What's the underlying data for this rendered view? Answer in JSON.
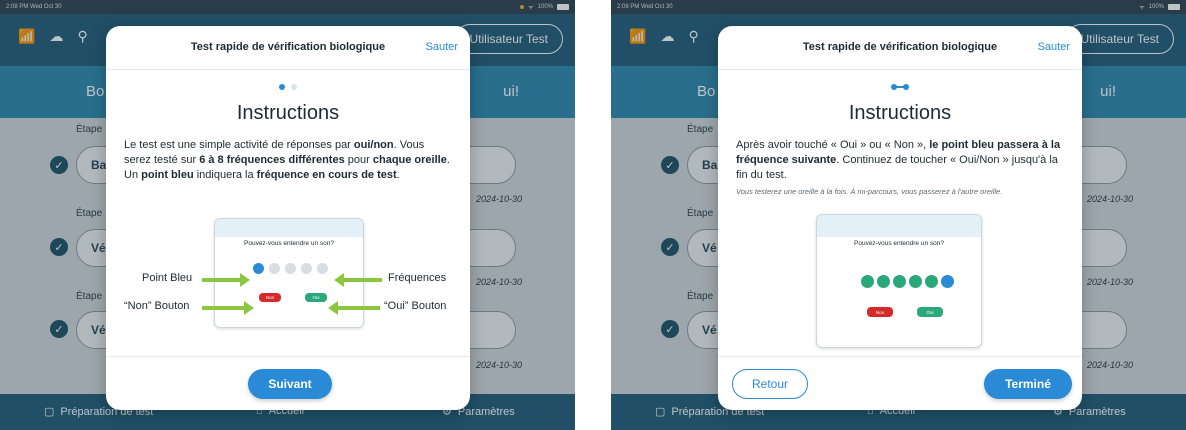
{
  "status": {
    "time": "2:08 PM  Wed Oct 30",
    "battery": "100%"
  },
  "topbar": {
    "user_label": "Utilisateur Test"
  },
  "banner": {
    "left_fragment": "Bo",
    "right_fragment": "ui!",
    "right_fragment_alt": "ui!"
  },
  "background": {
    "stage_label": "Étape",
    "items": [
      {
        "pill_left": "Ba",
        "date": "2024-10-30"
      },
      {
        "pill_left": "Vé",
        "date": "2024-10-30"
      },
      {
        "pill_left": "Vé",
        "date": "2024-10-30"
      }
    ],
    "last_date": "2024-10-30"
  },
  "bottom_nav": {
    "prep": "Préparation de test",
    "home": "Accueil",
    "settings": "Paramètres"
  },
  "modal": {
    "title": "Test rapide de vérification biologique",
    "skip": "Sauter",
    "heading": "Instructions"
  },
  "page1": {
    "body_parts": [
      {
        "t": "Le test est une simple activité de réponses par ",
        "b": false
      },
      {
        "t": "oui/non",
        "b": true
      },
      {
        "t": ". Vous serez testé sur ",
        "b": false
      },
      {
        "t": "6 à 8 fréquences différentes",
        "b": true
      },
      {
        "t": " pour ",
        "b": false
      },
      {
        "t": "chaque oreille",
        "b": true
      },
      {
        "t": ". Un ",
        "b": false
      },
      {
        "t": "point bleu",
        "b": true
      },
      {
        "t": " indiquera la ",
        "b": false
      },
      {
        "t": "fréquence en cours de test",
        "b": true
      },
      {
        "t": ".",
        "b": false
      }
    ],
    "illus_title": "Pouvez-vous entendre un son?",
    "labels": {
      "point_bleu": "Point Bleu",
      "frequences": "Fréquences",
      "non_bouton": "“Non” Bouton",
      "oui_bouton": "“Oui” Bouton"
    },
    "illus_buttons": {
      "non": "Non",
      "oui": "Oui"
    },
    "next_button": "Suivant"
  },
  "page2": {
    "body_parts": [
      {
        "t": "Après avoir touché « Oui » ou « Non », ",
        "b": false
      },
      {
        "t": "le point bleu passera à la fréquence suivante",
        "b": true
      },
      {
        "t": ". Continuez de toucher « Oui/Non » jusqu'à la fin du test.",
        "b": false
      }
    ],
    "note": "Vous testerez une oreille à la fois. À mi-parcours, vous passerez à l'autre oreille.",
    "illus_title": "Pouvez-vous entendre un son?",
    "illus_buttons": {
      "non": "Non",
      "oui": "Oui"
    },
    "back_button": "Retour",
    "done_button": "Terminé"
  },
  "colors": {
    "primary_blue": "#2b8ad6",
    "app_bar": "#1e5a78",
    "banner": "#2a86ad",
    "success_green": "#2aa87a",
    "arrow_green": "#8cc63f",
    "no_red": "#d42a2a"
  }
}
